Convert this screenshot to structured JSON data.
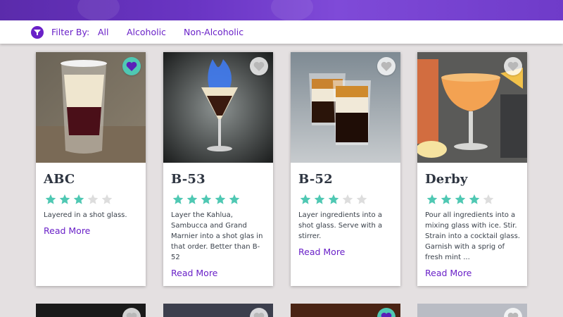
{
  "filter": {
    "label": "Filter By:",
    "options": [
      "All",
      "Alcoholic",
      "Non-Alcoholic"
    ]
  },
  "colors": {
    "accent": "#6a21c8",
    "star_filled": "#4fc8b3",
    "star_empty": "#dddddd",
    "fav_active": "#4fc8b3"
  },
  "cards": [
    {
      "title": "ABC",
      "rating": 3,
      "max_rating": 5,
      "favorite": true,
      "description": "Layered in a shot glass.",
      "read_more": "Read More"
    },
    {
      "title": "B-53",
      "rating": 5,
      "max_rating": 5,
      "favorite": false,
      "description": "Layer the Kahlua, Sambucca and Grand Marnier into a shot glas in that order. Better than B-52",
      "read_more": "Read More"
    },
    {
      "title": "B-52",
      "rating": 3,
      "max_rating": 5,
      "favorite": false,
      "description": "Layer ingredients into a shot glass. Serve with a stirrer.",
      "read_more": "Read More"
    },
    {
      "title": "Derby",
      "rating": 4,
      "max_rating": 5,
      "favorite": false,
      "description": "Pour all ingredients into a mixing glass with ice. Stir. Strain into a cocktail glass. Garnish with a sprig of fresh mint ...",
      "read_more": "Read More"
    }
  ],
  "bottom_cards": [
    {
      "favorite": false
    },
    {
      "favorite": false
    },
    {
      "favorite": true
    },
    {
      "favorite": false
    }
  ]
}
